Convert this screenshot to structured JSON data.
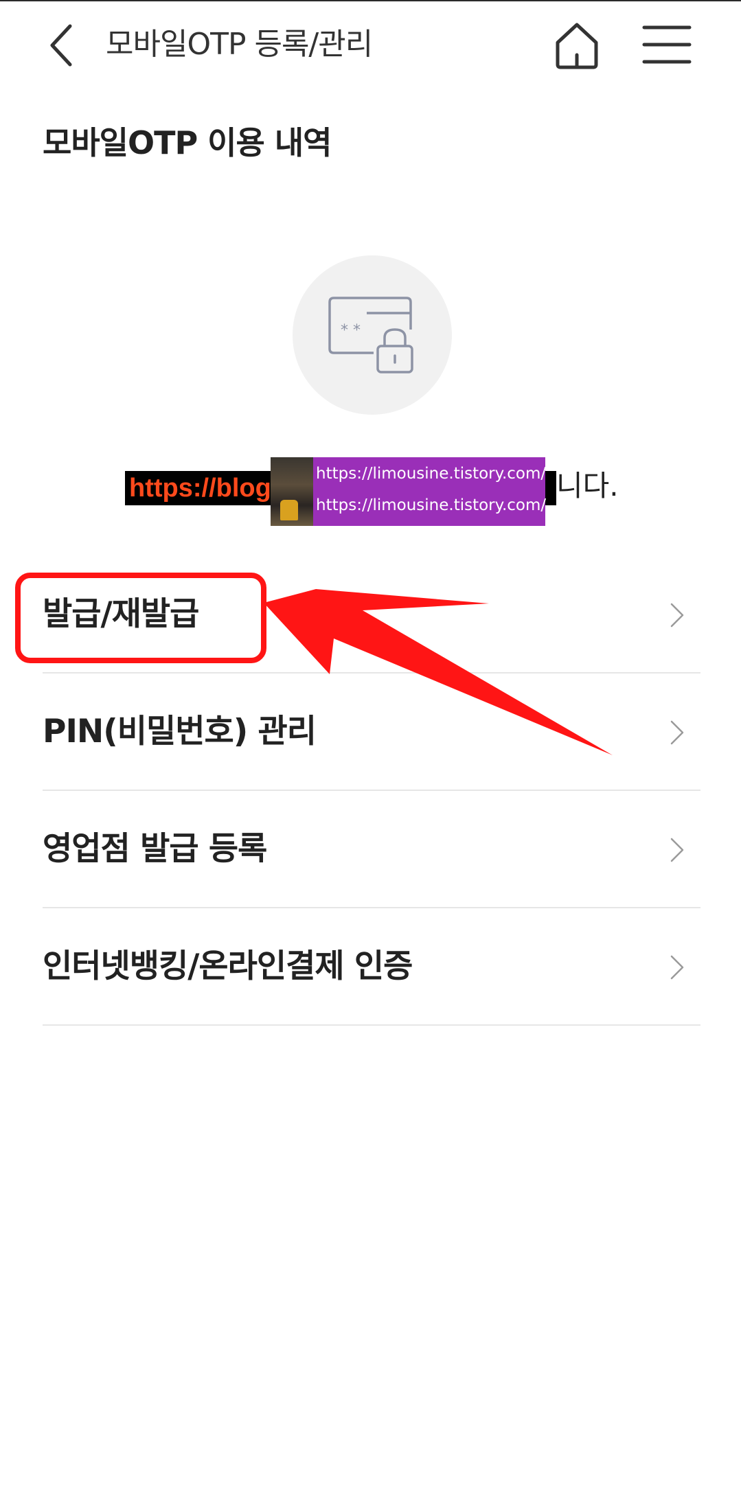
{
  "header": {
    "title": "모바일OTP 등록/관리",
    "back_icon": "chevron-left-icon",
    "home_icon": "home-icon",
    "menu_icon": "hamburger-menu-icon"
  },
  "section": {
    "title": "모바일OTP 이용 내역"
  },
  "empty_state": {
    "icon": "otp-card-lock-icon",
    "watermark_red_text": "https://blog",
    "watermark_url_1": "https://limousine.tistory.com/",
    "watermark_url_2": "https://limousine.tistory.com/",
    "message_tail": "니다."
  },
  "menu": {
    "items": [
      {
        "label": "발급/재발급"
      },
      {
        "label": "PIN(비밀번호) 관리"
      },
      {
        "label": "영업점 발급 등록"
      },
      {
        "label": "인터넷뱅킹/온라인결제 인증"
      }
    ],
    "chevron_icon": "chevron-right-icon"
  },
  "annotation": {
    "color": "#ff1515"
  },
  "colors": {
    "background": "#ffffff",
    "text": "#222222",
    "divider": "#e6e6e6",
    "icon_circle": "#f1f1f1",
    "icon_stroke": "#8d93a5"
  }
}
